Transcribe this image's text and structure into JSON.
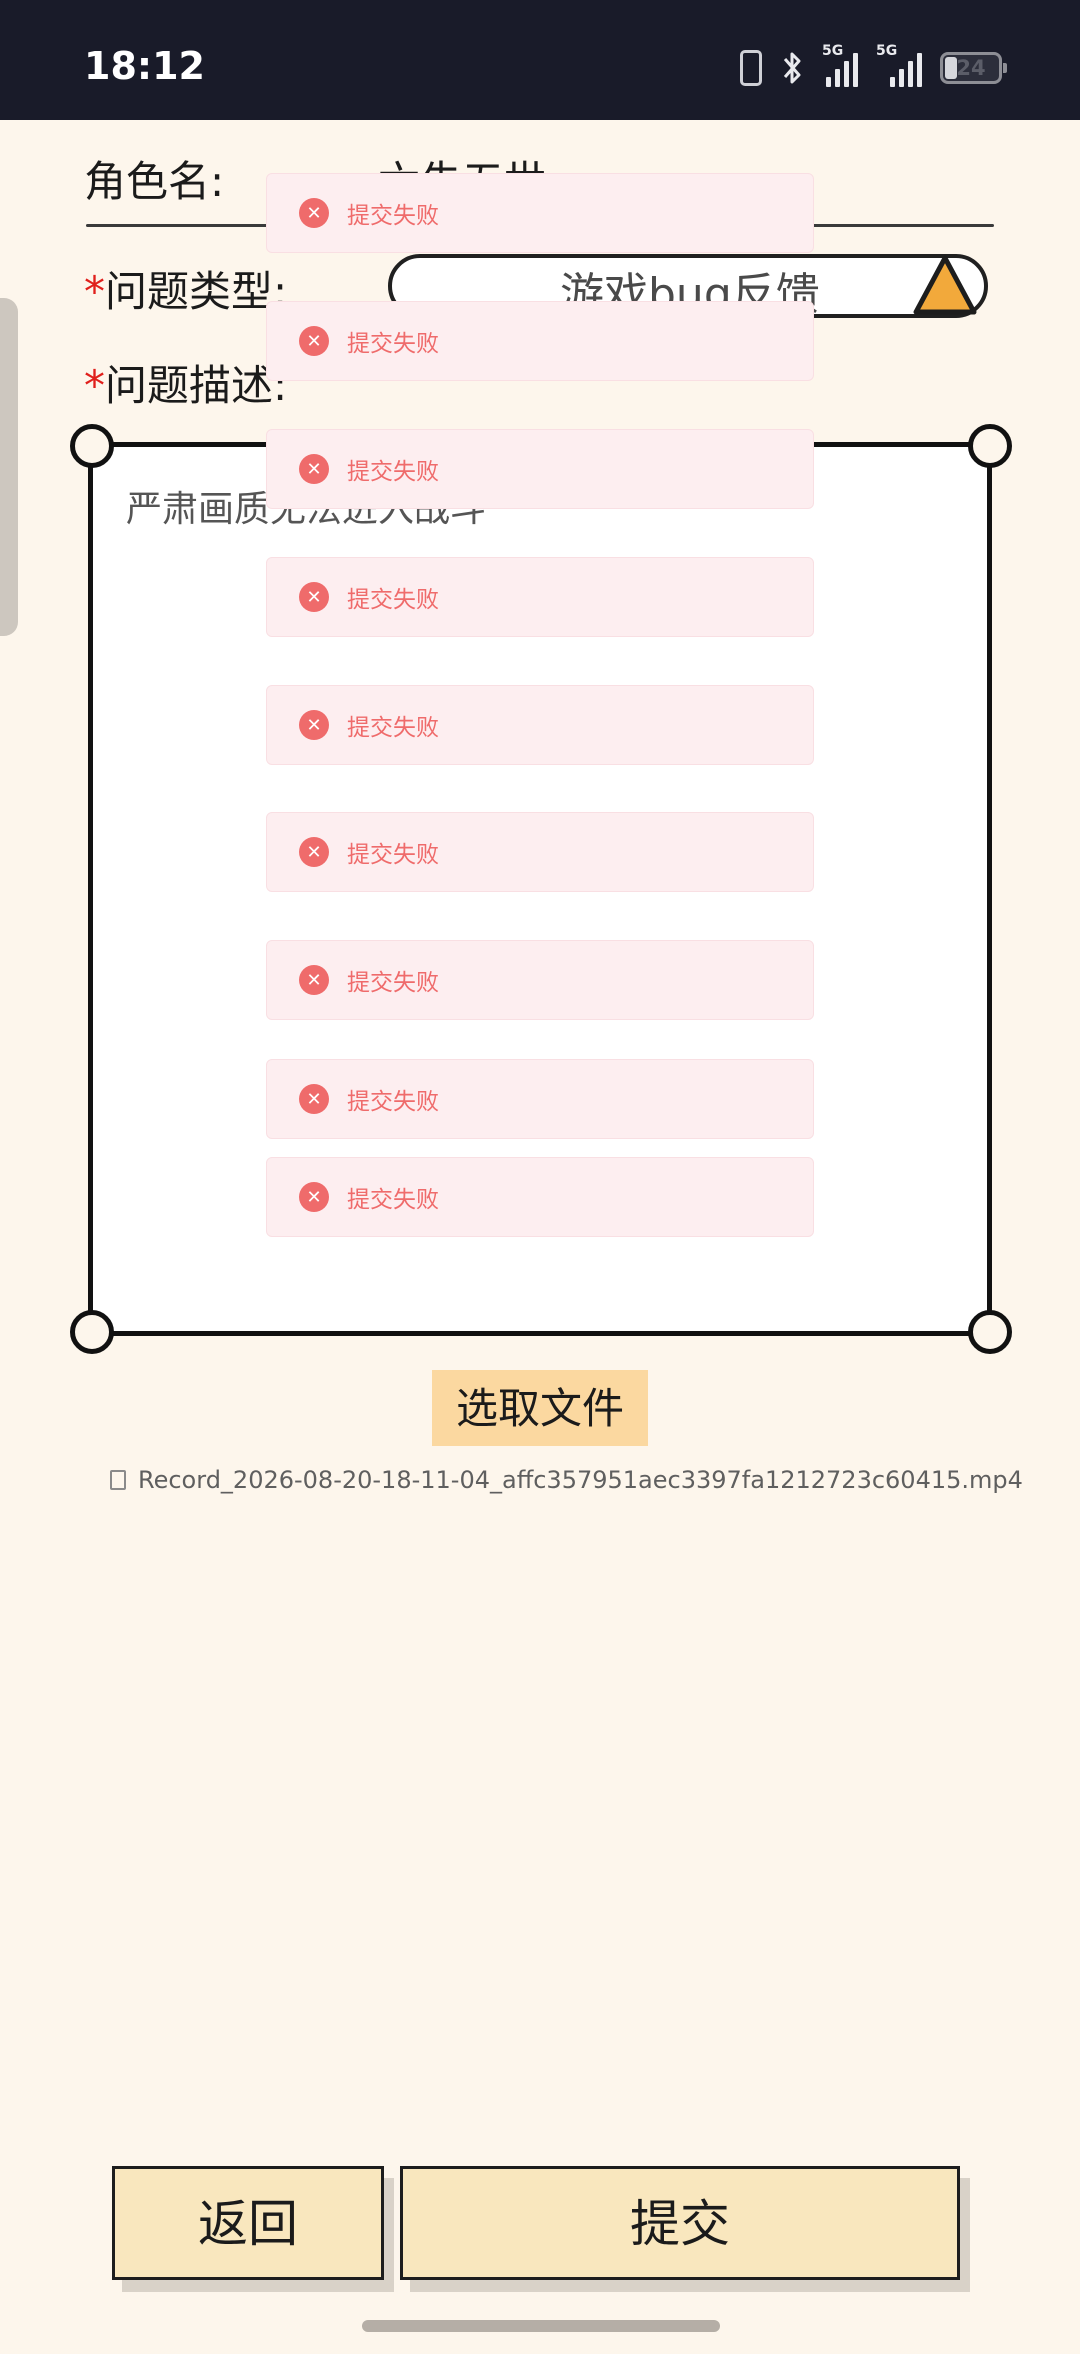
{
  "status_bar": {
    "time": "18:12",
    "network_1": "5G",
    "network_2": "5G",
    "battery": "24"
  },
  "form": {
    "role_label": "角色名:",
    "role_value": "六朱五世",
    "type_label": "问题类型:",
    "type_value": "游戏bug反馈",
    "desc_label": "问题描述:",
    "desc_value": "严肃画质无法进入战斗",
    "required_mark": "*"
  },
  "file": {
    "pick_button": "选取文件",
    "file_name": "Record_2026-08-20-18-11-04_affc357951aec3397fa1212723c60415.mp4"
  },
  "buttons": {
    "back": "返回",
    "submit": "提交"
  },
  "toasts": [
    {
      "message": "提交失败"
    },
    {
      "message": "提交失败"
    },
    {
      "message": "提交失败"
    },
    {
      "message": "提交失败"
    },
    {
      "message": "提交失败"
    },
    {
      "message": "提交失败"
    },
    {
      "message": "提交失败"
    },
    {
      "message": "提交失败"
    },
    {
      "message": "提交失败"
    }
  ],
  "colors": {
    "background": "#fdf6ec",
    "required": "#e0201c",
    "toast_bg": "#fdeef0",
    "toast_text": "#ef6b6b",
    "pick_button": "#fbd8a0",
    "bottom_button": "#f9e7be",
    "select_arrow": "#f2a93b"
  }
}
